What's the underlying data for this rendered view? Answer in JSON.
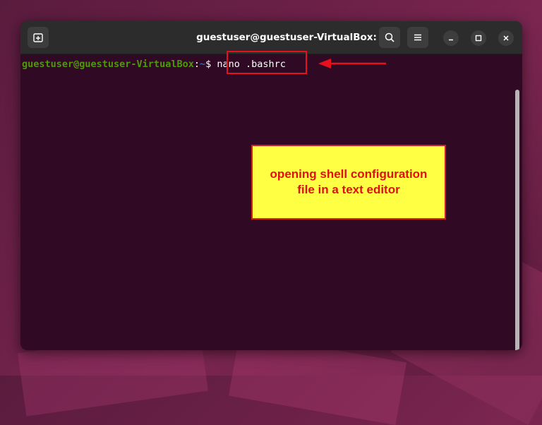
{
  "window": {
    "title": "guestuser@guestuser-VirtualBox: ~"
  },
  "titlebar": {
    "new_tab_icon": "new-tab-icon",
    "search_icon": "search-icon",
    "menu_icon": "hamburger-menu-icon",
    "minimize_icon": "minimize-icon",
    "maximize_icon": "maximize-icon",
    "close_icon": "close-icon"
  },
  "terminal": {
    "prompt_user": "guestuser@guestuser-VirtualBox",
    "prompt_separator": ":",
    "prompt_path": "~",
    "prompt_symbol": "$",
    "command": "nano .bashrc"
  },
  "annotation": {
    "text": "opening shell configuration file in a text editor"
  },
  "colors": {
    "terminal_bg": "#300a24",
    "titlebar_bg": "#2c2c2c",
    "prompt_user": "#4e9a06",
    "prompt_path": "#3465a4",
    "highlight_red": "#e8101c",
    "note_bg": "#ffff44",
    "note_text": "#e01010"
  }
}
